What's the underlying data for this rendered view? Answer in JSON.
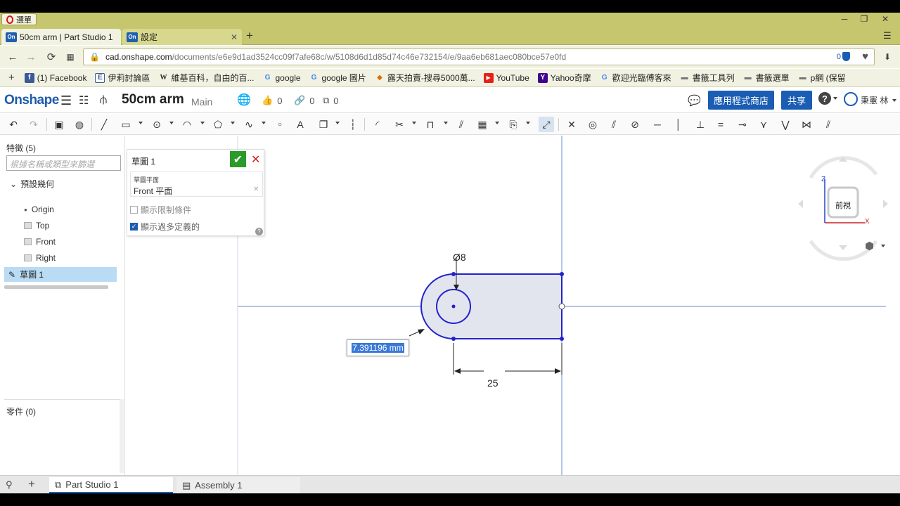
{
  "browser": {
    "menu_label": "選單",
    "tabs": [
      {
        "favicon": "On",
        "label": "50cm arm | Part Studio 1",
        "active": true
      },
      {
        "favicon": "On",
        "label": "設定",
        "active": false
      }
    ],
    "url_host": "cad.onshape.com",
    "url_path": "/documents/e6e9d1ad3524cc09f7afe68c/w/5108d6d1d85d74c46e732154/e/9aa6eb681aec080bce57e0fd",
    "shield_count": "0",
    "bookmarks": [
      {
        "icon": "facebook-icon",
        "label": "(1) Facebook"
      },
      {
        "icon": "forum-icon",
        "label": "伊莉討論區"
      },
      {
        "icon": "wikipedia-icon",
        "label": "維基百科，自由的百..."
      },
      {
        "icon": "google-icon",
        "label": "google"
      },
      {
        "icon": "google-icon",
        "label": "google 圖片"
      },
      {
        "icon": "ruten-icon",
        "label": "露天拍賣-搜尋5000萬..."
      },
      {
        "icon": "youtube-icon",
        "label": "YouTube"
      },
      {
        "icon": "yahoo-icon",
        "label": "Yahoo奇摩"
      },
      {
        "icon": "google-icon",
        "label": "歡迎光臨傅客來"
      },
      {
        "icon": "folder-icon",
        "label": "書籤工具列"
      },
      {
        "icon": "folder-icon",
        "label": "書籤選單"
      },
      {
        "icon": "folder-icon",
        "label": "p網 (保留"
      }
    ]
  },
  "onshape": {
    "logo": "Onshape",
    "document_name": "50cm arm",
    "workspace": "Main",
    "likes": "0",
    "links": "0",
    "copies": "0",
    "app_store_label": "應用程式商店",
    "share_label": "共享",
    "help_label": "?",
    "user_name": "秉憲 林"
  },
  "feature_panel": {
    "title": "特徵 (5)",
    "filter_placeholder": "根據名稱或類型來篩選",
    "default_geometry": "預設幾何",
    "items": [
      "Origin",
      "Top",
      "Front",
      "Right"
    ],
    "sketch_item": "草圖 1",
    "parts_label": "零件 (0)"
  },
  "sketch_dialog": {
    "title": "草圖 1",
    "plane_label": "草圖平面",
    "plane_value": "Front 平面",
    "show_constraints": "顯示限制條件",
    "show_overdefined": "顯示過多定義的",
    "show_constraints_checked": false,
    "show_overdefined_checked": true
  },
  "canvas": {
    "dim_diameter": "Ø8",
    "dim_length": "25",
    "dim_input": "7.391196 mm",
    "view_cube_label": "前視",
    "axis_z": "Z",
    "axis_x": "X"
  },
  "bottom_tabs": [
    {
      "label": "Part Studio 1",
      "active": true
    },
    {
      "label": "Assembly 1",
      "active": false
    }
  ],
  "colors": {
    "onshape_blue": "#1a5db3",
    "sketch_line": "#2222cc",
    "browser_chrome": "#c5c66d",
    "selection": "#b9dbf3"
  }
}
